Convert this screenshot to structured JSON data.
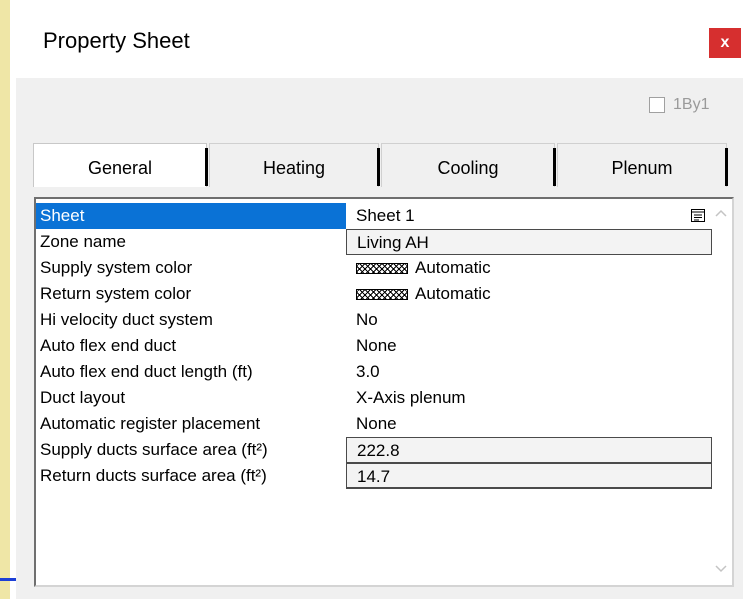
{
  "window": {
    "title": "Property Sheet",
    "close_label": "x"
  },
  "onebyone": {
    "label": "1By1",
    "checked": false
  },
  "tabs": [
    {
      "label": "General",
      "active": true
    },
    {
      "label": "Heating",
      "active": false
    },
    {
      "label": "Cooling",
      "active": false
    },
    {
      "label": "Plenum",
      "active": false
    }
  ],
  "properties": [
    {
      "name": "Sheet",
      "value": "Sheet 1"
    },
    {
      "name": "Zone name",
      "value": "Living AH"
    },
    {
      "name": "Supply system color",
      "value": "Automatic"
    },
    {
      "name": "Return system color",
      "value": "Automatic"
    },
    {
      "name": "Hi velocity duct system",
      "value": "No"
    },
    {
      "name": "Auto flex end duct",
      "value": "None"
    },
    {
      "name": "Auto flex end duct length (ft)",
      "value": "3.0"
    },
    {
      "name": "Duct layout",
      "value": "X-Axis plenum"
    },
    {
      "name": "Automatic register placement",
      "value": "None"
    },
    {
      "name": "Supply ducts surface area (ft²)",
      "value": "222.8"
    },
    {
      "name": "Return ducts surface area (ft²)",
      "value": "14.7"
    }
  ],
  "colors": {
    "selection": "#0a72d6",
    "close_button": "#d62f2f"
  },
  "icons": {
    "sheet_dropdown": "list-dropdown-icon",
    "scroll_up": "chevron-up-icon",
    "scroll_down": "chevron-down-icon"
  }
}
